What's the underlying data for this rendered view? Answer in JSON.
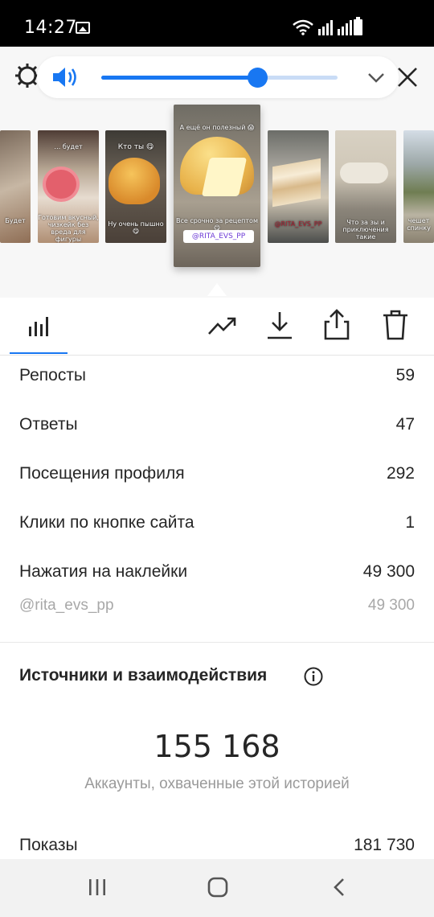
{
  "status": {
    "time": "14:27",
    "icons": [
      "gallery-icon",
      "wifi-icon",
      "signal-icon",
      "signal-icon",
      "battery-icon"
    ]
  },
  "player": {
    "volume_percent": 66,
    "accent": "#1877f2"
  },
  "stories": [
    {
      "caption": "Будет"
    },
    {
      "caption_top": "… будет",
      "caption_bottom": "Готовим вкусный, чизкейк без вреда для фигуры"
    },
    {
      "caption_top": "Кто ты 😋",
      "caption_bottom": "Ну очень пышно 😋"
    },
    {
      "caption_top": "А ещё он полезный 😱",
      "caption_bottom": "Все срочно за рецептом 😋",
      "tag": "@RITA_EVS_PP"
    },
    {
      "caption_bottom": "@RITA_EVS_PP"
    },
    {
      "caption_bottom": "Что за зы и приключения такие"
    },
    {
      "caption_bottom": "чешет спинку"
    }
  ],
  "tabs": {
    "icons": [
      "bar-chart-icon",
      "trending-up-icon",
      "download-icon",
      "share-icon",
      "trash-icon"
    ]
  },
  "stats": [
    {
      "label": "Репосты",
      "value": "59"
    },
    {
      "label": "Ответы",
      "value": "47"
    },
    {
      "label": "Посещения профиля",
      "value": "292"
    },
    {
      "label": "Клики по кнопке сайта",
      "value": "1"
    },
    {
      "label": "Нажатия на наклейки",
      "value": "49 300"
    }
  ],
  "sticker": {
    "label": "@rita_evs_pp",
    "value": "49 300"
  },
  "sources": {
    "title": "Источники и взаимодействия",
    "reach": "155 168",
    "reach_caption": "Аккаунты, охваченные этой историей",
    "impressions_label": "Показы",
    "impressions_value": "181 730"
  }
}
